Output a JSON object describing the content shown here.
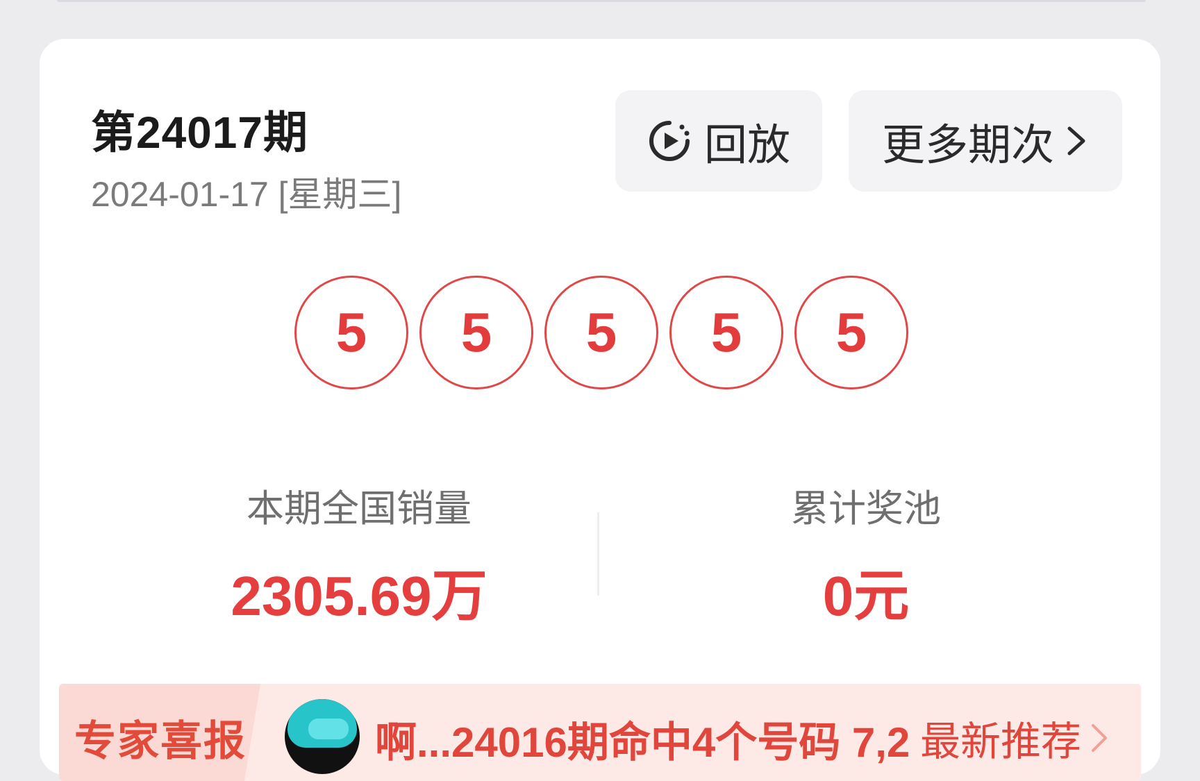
{
  "header": {
    "period": "第24017期",
    "date": "2024-01-17 [星期三]"
  },
  "actions": {
    "replay_label": "回放",
    "more_label": "更多期次"
  },
  "draw": {
    "numbers": [
      "5",
      "5",
      "5",
      "5",
      "5"
    ]
  },
  "stats": {
    "sales_label": "本期全国销量",
    "sales_value": "2305.69万",
    "pool_label": "累计奖池",
    "pool_value": "0元"
  },
  "banner": {
    "tag": "专家喜报",
    "text": "啊...24016期命中4个号码 7,2",
    "link": "最新推荐"
  },
  "colors": {
    "accent_red": "#e23c3c",
    "banner_bg": "#fde9e6",
    "button_bg": "#f3f3f6"
  }
}
